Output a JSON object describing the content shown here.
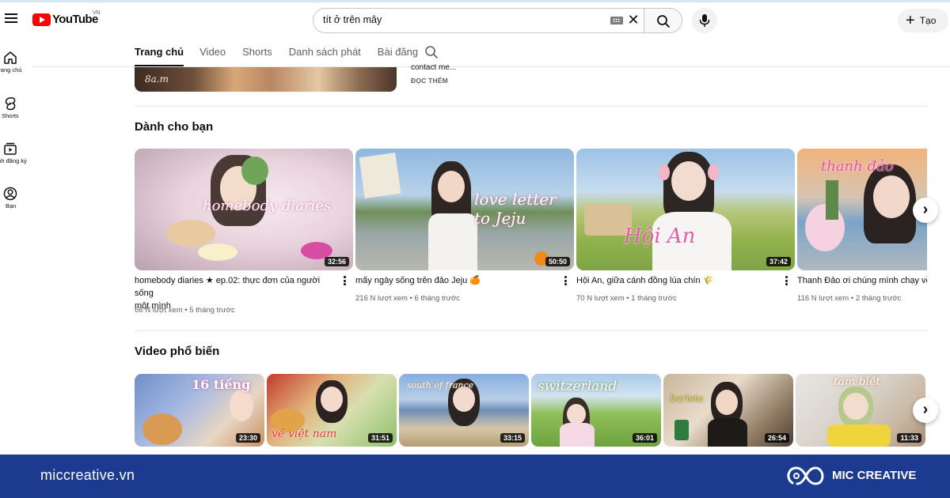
{
  "header": {
    "logo_text": "YouTube",
    "region": "VN",
    "search_query": "tít ở trên mây",
    "create_label": "Tạo"
  },
  "rail": [
    {
      "label": "Trang chủ",
      "icon": "home-icon"
    },
    {
      "label": "Shorts",
      "icon": "shorts-icon"
    },
    {
      "label": "Kênh đăng ký",
      "icon": "subscriptions-icon"
    },
    {
      "label": "Bạn",
      "icon": "you-icon"
    }
  ],
  "tabs": [
    "Trang chủ",
    "Video",
    "Shorts",
    "Danh sách phát",
    "Bài đăng"
  ],
  "featured": {
    "thumb_text": "8a.m",
    "desc_tail": "contact me...",
    "read_more": "ĐỌC THÊM"
  },
  "sections": {
    "for_you": {
      "title": "Dành cho bạn",
      "videos": [
        {
          "title_line1": "homebody diaries ★ ep.02: thực đơn của người sống",
          "title_line2": "một mình",
          "views": "66 N lượt xem",
          "age": "5 tháng trước",
          "duration": "32:56",
          "thumb_text": "homebody diaries"
        },
        {
          "title_line1": "mấy ngày sống trên đảo Jeju 🍊",
          "title_line2": "",
          "views": "216 N lượt xem",
          "age": "6 tháng trước",
          "duration": "50:50",
          "thumb_text": "love letter to Jeju"
        },
        {
          "title_line1": "Hội An, giữa cánh đồng lúa chín 🌾",
          "title_line2": "",
          "views": "70 N lượt xem",
          "age": "1 tháng trước",
          "duration": "37:42",
          "thumb_text": "Hội An"
        },
        {
          "title_line1": "Thanh Đảo ơi chúng mình chạy về",
          "title_line2": "",
          "views": "116 N lượt xem",
          "age": "2 tháng trước",
          "duration": "",
          "thumb_text": "thanh đảo"
        }
      ]
    },
    "popular": {
      "title": "Video phổ biến",
      "videos": [
        {
          "duration": "23:30",
          "thumb_text": "16 tiếng"
        },
        {
          "duration": "31:51",
          "thumb_text": "về việt nam"
        },
        {
          "duration": "33:15",
          "thumb_text": "south of france"
        },
        {
          "duration": "36:01",
          "thumb_text": "switzerland"
        },
        {
          "duration": "26:54",
          "thumb_text": "barista"
        },
        {
          "duration": "11:33",
          "thumb_text": "tam biệt"
        }
      ]
    }
  },
  "banner": {
    "url": "miccreative.vn",
    "brand": "MIC CREATIVE"
  }
}
